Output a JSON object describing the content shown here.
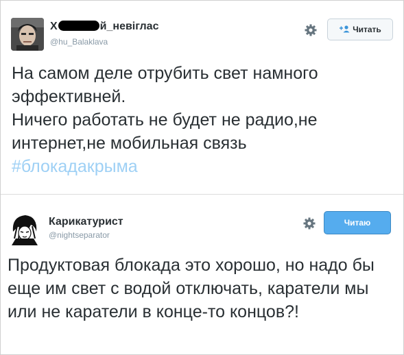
{
  "tweets": [
    {
      "name_prefix": "Х",
      "name_suffix": "й_невіглас",
      "handle": "@hu_Balaklava",
      "follow_label": "Читать",
      "text": "На самом деле отрубить свет намного эффективней.\nНичего работать не будет не радио,не интернет,не мобильная связь",
      "hashtag": "#блокадакрыма"
    },
    {
      "name": "Карикатурист",
      "handle": "@nightseparator",
      "follow_label": "Читаю",
      "text": "Продуктовая блокада это хорошо, но надо бы еще им свет с водой отключать, каратели мы или не каратели в конце-то концов?!"
    }
  ],
  "icons": {
    "settings": "gear-icon",
    "follow": "add-user-icon"
  },
  "colors": {
    "hashtag": "#9ed0f5",
    "following_button": "#55acee",
    "text": "#292f33",
    "handle": "#8899a6"
  }
}
